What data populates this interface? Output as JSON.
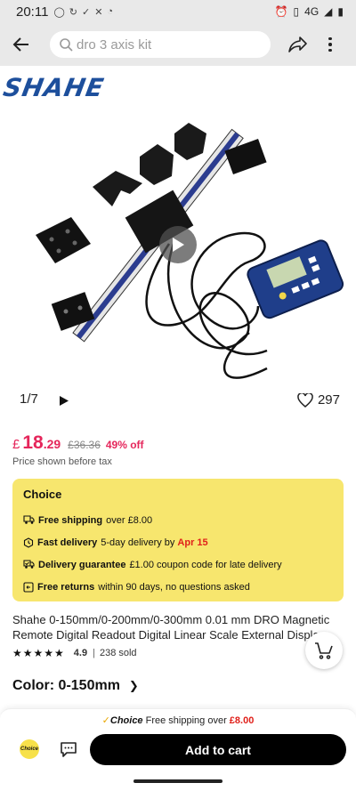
{
  "status_bar": {
    "time": "20:11",
    "network": "4G"
  },
  "top_bar": {
    "search_placeholder": "dro 3 axis kit"
  },
  "gallery": {
    "brand": "SHAHE",
    "counter": "1/7",
    "wishlist_count": "297"
  },
  "price": {
    "currency": "£",
    "main": "18",
    "decimals": ".29",
    "original": "£36.36",
    "discount": "49% off",
    "note": "Price shown before tax"
  },
  "choice": {
    "title": "Choice",
    "lines": [
      {
        "bold": "Free shipping",
        "text": "over £8.00",
        "highlight": ""
      },
      {
        "bold": "Fast delivery",
        "text": "5-day delivery by",
        "highlight": "Apr 15"
      },
      {
        "bold": "Delivery guarantee",
        "text": "£1.00 coupon code for late delivery",
        "highlight": ""
      },
      {
        "bold": "Free returns",
        "text": "within 90 days, no questions asked",
        "highlight": ""
      }
    ]
  },
  "product": {
    "title_line1": "Shahe 0-150mm/0-200mm/0-300mm 0.01 mm DRO Magnetic",
    "title_line2": "Remote Digital Readout Digital Linear Scale External Display",
    "stars": "★★★★★",
    "rating": "4.9",
    "sold": "238 sold",
    "color_label": "Color: 0-150mm"
  },
  "bottom_bar": {
    "banner_choice": "Choice",
    "banner_text": "Free shipping over",
    "banner_amount": "£8.00",
    "badge": "Choice",
    "add_to_cart": "Add to cart"
  },
  "colors": {
    "accent_red": "#e5265b",
    "choice_yellow": "#f7e66e",
    "brand_blue": "#1d4f9c"
  }
}
